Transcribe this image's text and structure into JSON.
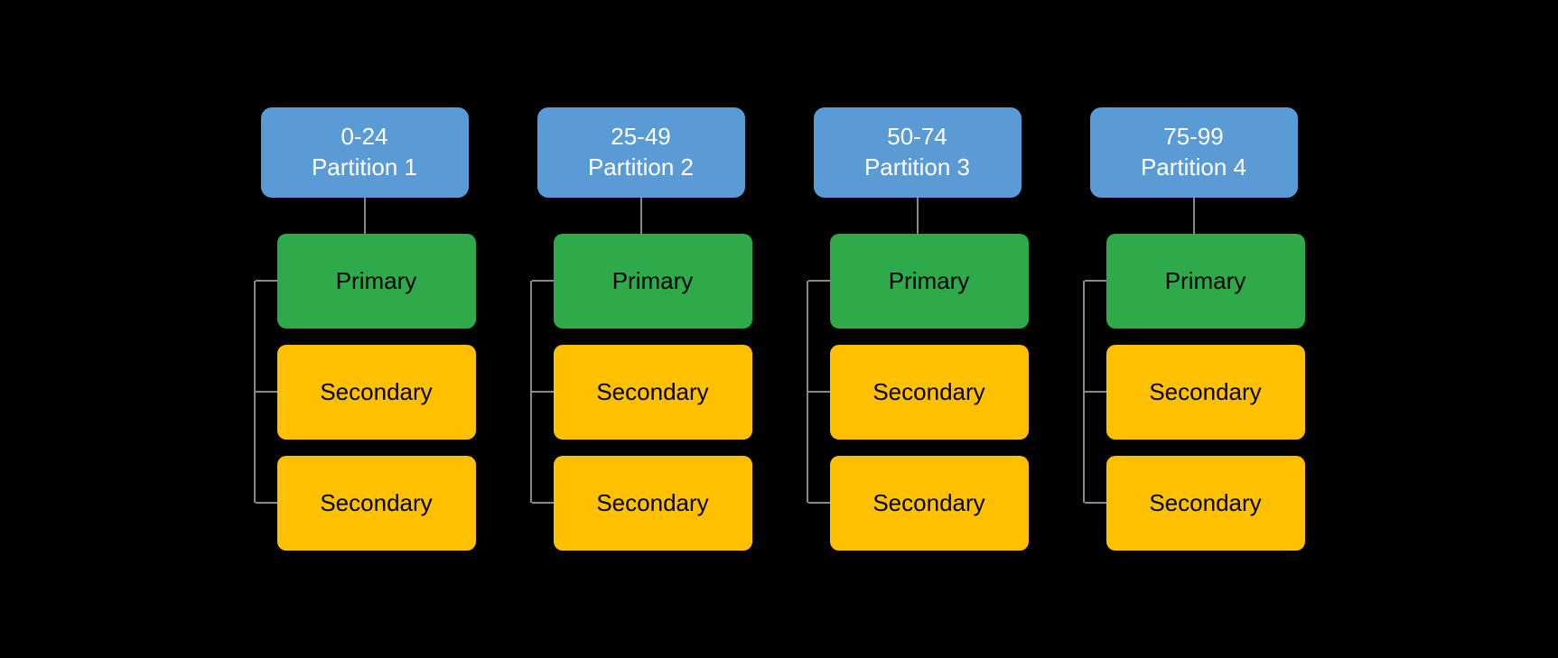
{
  "partitions": [
    {
      "id": "p1",
      "label_line1": "0-24",
      "label_line2": "Partition 1",
      "primary_label": "Primary",
      "secondary_labels": [
        "Secondary",
        "Secondary"
      ]
    },
    {
      "id": "p2",
      "label_line1": "25-49",
      "label_line2": "Partition 2",
      "primary_label": "Primary",
      "secondary_labels": [
        "Secondary",
        "Secondary"
      ]
    },
    {
      "id": "p3",
      "label_line1": "50-74",
      "label_line2": "Partition 3",
      "primary_label": "Primary",
      "secondary_labels": [
        "Secondary",
        "Secondary"
      ]
    },
    {
      "id": "p4",
      "label_line1": "75-99",
      "label_line2": "Partition 4",
      "primary_label": "Primary",
      "secondary_labels": [
        "Secondary",
        "Secondary"
      ]
    }
  ]
}
